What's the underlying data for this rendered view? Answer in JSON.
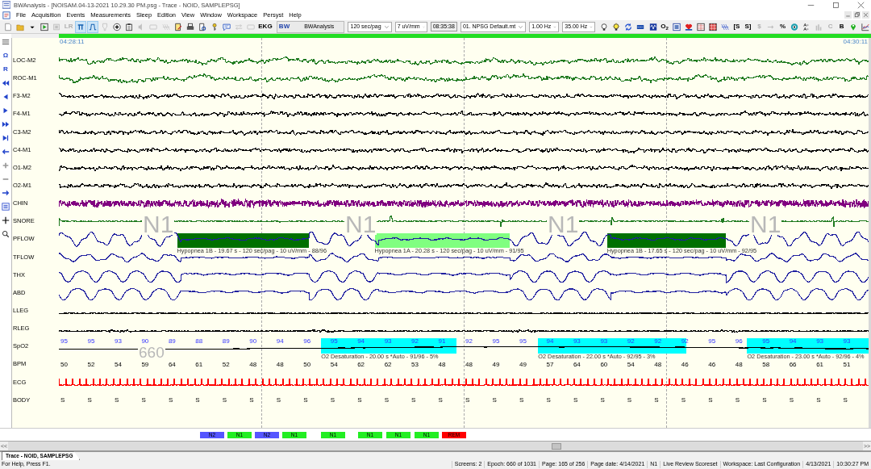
{
  "window": {
    "title": "BWAnalysis - [NOISAM.04-13-2021 10.29.30 PM.psg - Trace - NOID, SAMPLEPSG]"
  },
  "menu": [
    "File",
    "Acquisition",
    "Events",
    "Measurements",
    "Sleep",
    "Edition",
    "View",
    "Window",
    "Workspace",
    "Persyst",
    "Help"
  ],
  "toolbar": [
    {
      "kind": "icon",
      "pressed": false,
      "disabled": false
    },
    {
      "kind": "icon",
      "pressed": false,
      "disabled": false
    },
    {
      "kind": "icon",
      "pressed": false,
      "disabled": false
    },
    {
      "kind": "icon",
      "pressed": false,
      "disabled": false
    },
    {
      "kind": "icon",
      "pressed": false,
      "disabled": true
    },
    {
      "kind": "text",
      "label": "LR",
      "pressed": false,
      "disabled": true
    },
    {
      "kind": "icon",
      "pressed": true,
      "disabled": false
    },
    {
      "kind": "icon",
      "pressed": true,
      "disabled": false
    },
    {
      "kind": "icon",
      "pressed": false,
      "disabled": true
    },
    {
      "kind": "icon",
      "pressed": false,
      "disabled": false
    },
    {
      "kind": "icon",
      "pressed": false,
      "disabled": false
    },
    {
      "kind": "icon",
      "pressed": false,
      "disabled": true
    },
    {
      "kind": "icon",
      "pressed": false,
      "disabled": true
    },
    {
      "kind": "icon",
      "pressed": false,
      "disabled": true
    },
    {
      "kind": "icon",
      "pressed": false,
      "disabled": false
    },
    {
      "kind": "icon",
      "pressed": false,
      "disabled": false
    },
    {
      "kind": "icon",
      "pressed": false,
      "disabled": false
    },
    {
      "kind": "icon",
      "pressed": false,
      "disabled": false
    },
    {
      "kind": "icon",
      "pressed": false,
      "disabled": false
    },
    {
      "kind": "icon",
      "pressed": false,
      "disabled": true
    },
    {
      "kind": "icon",
      "pressed": false,
      "disabled": true
    },
    {
      "kind": "text",
      "label": "EKG",
      "pressed": false,
      "disabled": false
    },
    {
      "kind": "app_label",
      "logo": "BW",
      "label": "BWAnalysis"
    },
    {
      "kind": "select",
      "value": "120 sec/pag"
    },
    {
      "kind": "select",
      "value": "7 uV/mm"
    },
    {
      "kind": "field",
      "value": "08:35:38"
    },
    {
      "kind": "select",
      "value": "01. NPSG Default.mt"
    },
    {
      "kind": "select",
      "value": "1.00 Hz"
    },
    {
      "kind": "select",
      "value": "35.00 Hz"
    },
    {
      "kind": "icon",
      "pressed": false,
      "disabled": false
    },
    {
      "kind": "icon",
      "pressed": false,
      "disabled": false
    },
    {
      "kind": "icon",
      "pressed": false,
      "disabled": false
    },
    {
      "kind": "icon",
      "pressed": false,
      "disabled": false
    },
    {
      "kind": "icon",
      "pressed": false,
      "disabled": false
    },
    {
      "kind": "text",
      "label": "O$_{2}$",
      "pressed": false,
      "disabled": false
    },
    {
      "kind": "icon",
      "pressed": false,
      "disabled": false
    },
    {
      "kind": "icon",
      "pressed": false,
      "disabled": false
    },
    {
      "kind": "icon",
      "pressed": false,
      "disabled": false
    },
    {
      "kind": "icon",
      "pressed": false,
      "disabled": false
    },
    {
      "kind": "icon",
      "pressed": false,
      "disabled": false
    },
    {
      "kind": "text",
      "label": "[S",
      "pressed": false,
      "disabled": false
    },
    {
      "kind": "text",
      "label": "S]",
      "pressed": false,
      "disabled": false
    },
    {
      "kind": "text",
      "label": "$",
      "pressed": false,
      "disabled": true
    },
    {
      "kind": "icon",
      "pressed": false,
      "disabled": true
    },
    {
      "kind": "text",
      "label": "%",
      "pressed": false,
      "disabled": false
    },
    {
      "kind": "icon",
      "pressed": false,
      "disabled": false
    },
    {
      "kind": "icon",
      "pressed": false,
      "disabled": false
    },
    {
      "kind": "icon",
      "pressed": false,
      "disabled": true
    },
    {
      "kind": "text",
      "label": "C",
      "pressed": false,
      "disabled": true
    },
    {
      "kind": "text",
      "label": "B",
      "pressed": false,
      "disabled": false
    },
    {
      "kind": "icon",
      "pressed": false,
      "disabled": false
    },
    {
      "kind": "icon",
      "pressed": false,
      "disabled": false
    }
  ],
  "sidebar": [
    {
      "kind": "icon"
    },
    {
      "kind": "text",
      "label": "Ω"
    },
    {
      "kind": "text",
      "label": "R"
    },
    {
      "kind": "icon"
    },
    {
      "kind": "icon"
    },
    {
      "kind": "icon"
    },
    {
      "kind": "icon"
    },
    {
      "kind": "icon"
    },
    {
      "kind": "icon"
    },
    {
      "kind": "icon"
    },
    {
      "kind": "icon"
    },
    {
      "kind": "icon"
    },
    {
      "kind": "icon"
    },
    {
      "kind": "icon"
    },
    {
      "kind": "icon"
    }
  ],
  "time_start": "04:28:11",
  "time_end": "04:30:11",
  "channels": [
    {
      "label": "LOC-M2",
      "kind": "eeg",
      "color": "#1f7a1f"
    },
    {
      "label": "ROC-M1",
      "kind": "eeg",
      "color": "#1f7a1f"
    },
    {
      "label": "F3-M2",
      "kind": "eeg",
      "color": "#000000"
    },
    {
      "label": "F4-M1",
      "kind": "eeg",
      "color": "#000000"
    },
    {
      "label": "C3-M2",
      "kind": "eeg",
      "color": "#000000"
    },
    {
      "label": "C4-M1",
      "kind": "eeg",
      "color": "#000000"
    },
    {
      "label": "O1-M2",
      "kind": "eeg",
      "color": "#000000"
    },
    {
      "label": "O2-M1",
      "kind": "eeg",
      "color": "#000000"
    },
    {
      "label": "CHIN",
      "kind": "emg",
      "color": "#800080"
    },
    {
      "label": "SNORE",
      "kind": "snore",
      "color": "#1f7a1f"
    },
    {
      "label": "PFLOW",
      "kind": "resp",
      "color": "#2020a0",
      "events": [
        {
          "label": "Hypopnea 1B - 19.67 s - 120 sec/pag - 10 uV/mm - 88/96",
          "color": "#007000"
        },
        {
          "label": "Hypopnea 1A - 20.28 s - 120 sec/pag - 10 uV/mm - 91/95",
          "color": "#80ff80"
        },
        {
          "label": "Hypopnea 1B - 17.65 s - 120 sec/pag - 10 uV/mm - 92/95",
          "color": "#007000"
        }
      ]
    },
    {
      "label": "TFLOW",
      "kind": "resp",
      "color": "#2020a0"
    },
    {
      "label": "THX",
      "kind": "effort",
      "color": "#2020a0"
    },
    {
      "label": "ABD",
      "kind": "effort",
      "color": "#2020a0"
    },
    {
      "label": "LLEG",
      "kind": "leg",
      "color": "#000000"
    },
    {
      "label": "RLEG",
      "kind": "leg",
      "color": "#000000"
    },
    {
      "label": "SpO2",
      "kind": "spo2",
      "color": "#000000",
      "values": [
        "95",
        "95",
        "93",
        "90",
        "89",
        "88",
        "89",
        "90",
        "94",
        "96",
        "95",
        "94",
        "93",
        "92",
        "91",
        "92",
        "95",
        "95",
        "94",
        "93",
        "93",
        "92",
        "92",
        "92",
        "95",
        "96",
        "95",
        "94",
        "93",
        "93"
      ],
      "events": [
        {
          "label": "O2 Desaturation - 20.00 s *Auto - 91/96 - 5%",
          "color": "#00ffff"
        },
        {
          "label": "O2 Desaturation - 22.00 s *Auto - 92/95 - 3%",
          "color": "#00ffff"
        },
        {
          "label": "O2 Desaturation - 23.00 s *Auto - 92/96 - 4%",
          "color": "#00ffff"
        }
      ]
    },
    {
      "label": "BPM",
      "kind": "numeric",
      "values": [
        "50",
        "52",
        "54",
        "59",
        "64",
        "61",
        "52",
        "48",
        "48",
        "50",
        "54",
        "62",
        "62",
        "53",
        "48",
        "48",
        "49",
        "49",
        "57",
        "64",
        "60",
        "54",
        "48",
        "46",
        "46",
        "48",
        "58",
        "66",
        "61",
        "51"
      ]
    },
    {
      "label": "ECG",
      "kind": "ecg",
      "color": "#ff0000"
    },
    {
      "label": "BODY",
      "kind": "position",
      "values": [
        "S",
        "S",
        "S",
        "S",
        "S",
        "S",
        "S",
        "S",
        "S",
        "S",
        "S",
        "S",
        "S",
        "S",
        "S",
        "S",
        "S",
        "S",
        "S",
        "S",
        "S",
        "S",
        "S",
        "S",
        "S",
        "S",
        "S",
        "S",
        "S",
        "S"
      ]
    }
  ],
  "epochs": [
    {
      "stage": "N1",
      "number": "660"
    },
    {
      "stage": "N1"
    },
    {
      "stage": "N1"
    },
    {
      "stage": "N1"
    }
  ],
  "hypnogram": [
    {
      "stage": "N2",
      "color": "#5555ff"
    },
    {
      "stage": "N1",
      "color": "#22ee22"
    },
    {
      "stage": "N2",
      "color": "#5555ff"
    },
    {
      "stage": "N1",
      "color": "#22ee22"
    },
    {
      "stage": "N1",
      "color": "#22ee22"
    },
    {
      "stage": "N1",
      "color": "#22ee22"
    },
    {
      "stage": "N1",
      "color": "#22ee22"
    },
    {
      "stage": "N1",
      "color": "#22ee22"
    },
    {
      "stage": "REM",
      "color": "#ff0000"
    }
  ],
  "scrollbar": {
    "left": "<<",
    "right": ">>"
  },
  "tabs": [
    {
      "label": "Trace - NOID, SAMPLEPSG",
      "selected": true
    }
  ],
  "status_bar": {
    "help": "For Help, Press F1.",
    "panes": [
      "Screens: 2",
      "Epoch: 660 of 1031",
      "Page: 165 of 256",
      "Page date: 4/14/2021",
      "N1",
      "Live Review Scoreset",
      "Workspace: Last Configuration",
      "4/13/2021",
      "10:30:27 PM"
    ]
  }
}
